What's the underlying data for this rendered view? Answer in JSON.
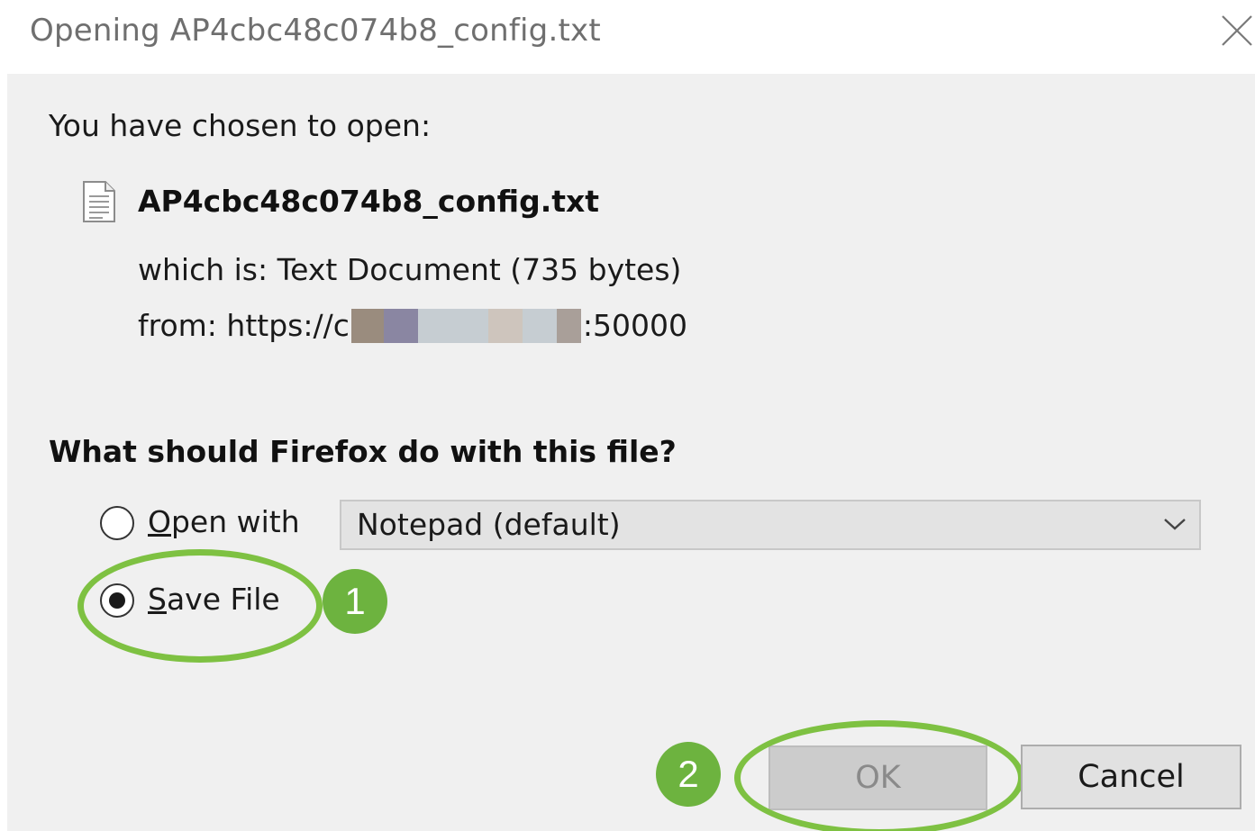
{
  "titlebar": {
    "title": "Opening AP4cbc48c074b8_config.txt",
    "close_icon": "close-icon"
  },
  "content": {
    "chosen_label": "You have chosen to open:",
    "file": {
      "icon": "text-file-icon",
      "name": "AP4cbc48c074b8_config.txt",
      "which_is_label": "which is:",
      "type_and_size": "Text Document (735 bytes)",
      "from_label": "from:",
      "from_scheme": "https://c",
      "from_port": ":50000"
    },
    "question": "What should Firefox do with this file?",
    "options": {
      "open_with": {
        "accel": "O",
        "rest": "pen with",
        "selected": false
      },
      "save_file": {
        "accel": "S",
        "rest": "ave File",
        "selected": true
      }
    },
    "app_select": {
      "value": "Notepad (default)",
      "icon": "chevron-down-icon"
    }
  },
  "annotations": {
    "badge_1": "1",
    "badge_2": "2",
    "ring_color": "#7ec142",
    "badge_color": "#6db33f"
  },
  "buttons": {
    "ok": "OK",
    "cancel": "Cancel"
  }
}
